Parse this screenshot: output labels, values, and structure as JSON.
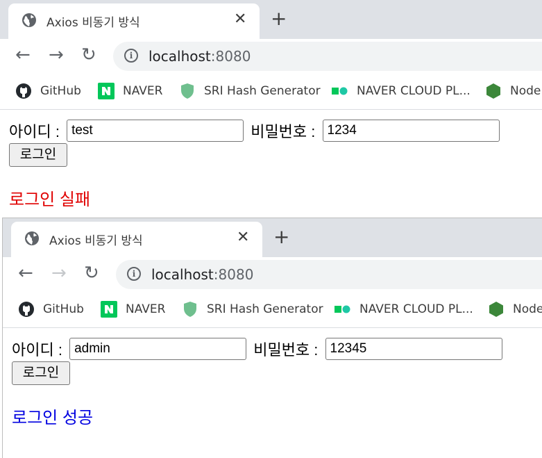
{
  "windows": [
    {
      "tab_title": "Axios 비동기 방식",
      "address": {
        "host": "localhost",
        "port": ":8080"
      },
      "forward_enabled": true,
      "bookmarks": [
        "GitHub",
        "NAVER",
        "SRI Hash Generator",
        "NAVER CLOUD PL...",
        "Node"
      ],
      "form": {
        "id_label": "아이디 :",
        "id_value": "test",
        "pw_label": "비밀번호 :",
        "pw_value": "1234",
        "login_button": "로그인"
      },
      "result": {
        "text": "로그인 실패",
        "color": "#e00000"
      }
    },
    {
      "tab_title": "Axios 비동기 방식",
      "address": {
        "host": "localhost",
        "port": ":8080"
      },
      "forward_enabled": false,
      "bookmarks": [
        "GitHub",
        "NAVER",
        "SRI Hash Generator",
        "NAVER CLOUD PL...",
        "Node"
      ],
      "form": {
        "id_label": "아이디 :",
        "id_value": "admin",
        "pw_label": "비밀번호 :",
        "pw_value": "12345",
        "login_button": "로그인"
      },
      "result": {
        "text": "로그인 성공",
        "color": "#0000e0"
      }
    }
  ],
  "icons": {
    "tab": "globe-icon",
    "close": "close-icon",
    "new_tab": "plus-icon",
    "back": "back-arrow-icon",
    "forward": "forward-arrow-icon",
    "reload": "reload-icon",
    "site_info": "info-icon",
    "bookmarks": [
      "github-icon",
      "naver-icon",
      "shield-icon",
      "naver-cloud-icon",
      "nodejs-icon"
    ]
  },
  "colors": {
    "tabstrip": "#dee1e6",
    "omnibox": "#f1f3f4",
    "fail": "#e00000",
    "success": "#0000e0"
  }
}
